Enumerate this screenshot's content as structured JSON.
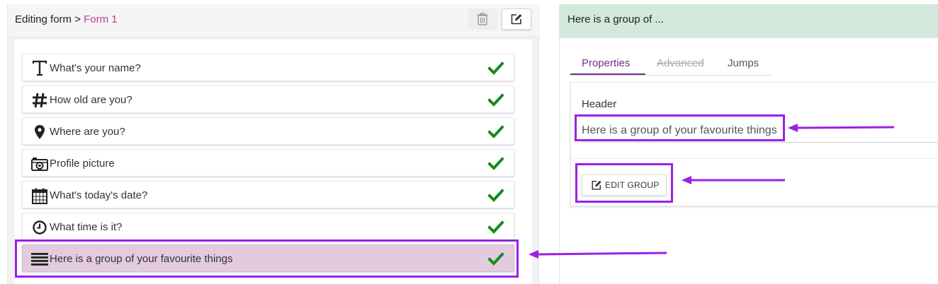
{
  "left_header": {
    "crumb": "Editing form >",
    "form_name": "Form 1"
  },
  "questions": [
    {
      "icon": "text-icon",
      "label": "What's your name?",
      "complete": true,
      "selected": false
    },
    {
      "icon": "hash-icon",
      "label": "How old are you?",
      "complete": true,
      "selected": false
    },
    {
      "icon": "location-pin-icon",
      "label": "Where are you?",
      "complete": true,
      "selected": false
    },
    {
      "icon": "camera-icon",
      "label": "Profile picture",
      "complete": true,
      "selected": false
    },
    {
      "icon": "calendar-icon",
      "label": "What's today's date?",
      "complete": true,
      "selected": false
    },
    {
      "icon": "clock-icon",
      "label": "What time is it?",
      "complete": true,
      "selected": false
    },
    {
      "icon": "group-lines-icon",
      "label": "Here is a group of your favourite things",
      "complete": true,
      "selected": true
    }
  ],
  "right_header": {
    "title": "Here is a group of ..."
  },
  "tabs": [
    {
      "label": "Properties",
      "state": "active"
    },
    {
      "label": "Advanced",
      "state": "disabled"
    },
    {
      "label": "Jumps",
      "state": "normal"
    }
  ],
  "properties": {
    "header_label": "Header",
    "header_value": "Here is a group of your favourite things",
    "edit_group_label": "EDIT GROUP"
  },
  "colors": {
    "accent_purple": "#7a2a8c",
    "form_link": "#b0449c",
    "highlight": "#9d1fe6",
    "selected_row": "#e3cbdf",
    "check_green": "#1a8a1a",
    "right_header_bg": "#d2e8dc"
  }
}
